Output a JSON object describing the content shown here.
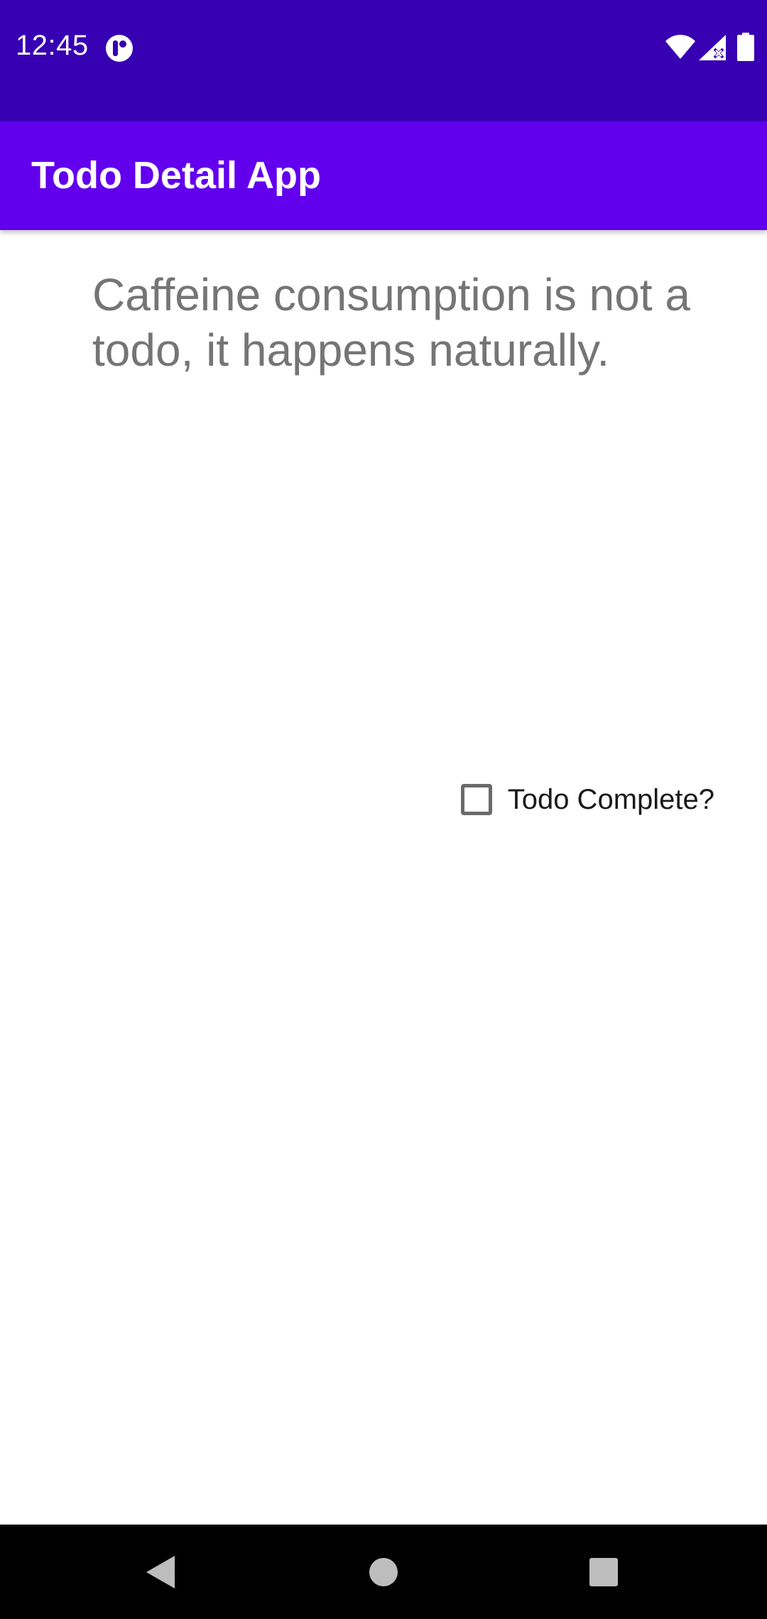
{
  "status_bar": {
    "time": "12:45",
    "app_icon": "notification-app-icon",
    "icons": [
      "wifi-icon",
      "signal-icon",
      "battery-icon"
    ]
  },
  "app_bar": {
    "title": "Todo Detail App"
  },
  "todo": {
    "title": "Caffeine consumption is not a todo, it happens naturally.",
    "checkbox_label": "Todo Complete?",
    "completed": false
  },
  "nav_bar": {
    "buttons": [
      "back-icon",
      "home-icon",
      "recents-icon"
    ]
  },
  "colors": {
    "status_bar": "#3700b3",
    "app_bar": "#6200ee",
    "title_text": "#757575"
  }
}
